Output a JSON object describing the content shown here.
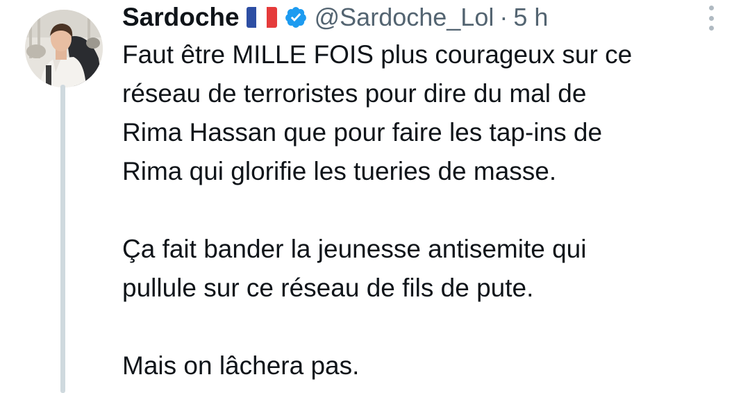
{
  "tweet": {
    "author": {
      "display_name": "Sardoche",
      "flag": "France flag",
      "verified": true,
      "handle": "@Sardoche_Lol"
    },
    "separator": "·",
    "timestamp": "5 h",
    "more_icon": "more-vertical-icon",
    "text": {
      "paragraph1": [
        "Faut être MILLE FOIS plus courageux sur ce",
        "réseau de terroristes pour dire du mal de",
        "Rima Hassan que pour faire les tap-ins de",
        "Rima qui glorifie les tueries de masse."
      ],
      "paragraph2": [
        "Ça fait bander la jeunesse antisemite qui",
        "pullule sur ce réseau de fils de pute."
      ],
      "paragraph3": [
        "Mais on lâchera pas."
      ]
    }
  },
  "colors": {
    "text_primary": "#0f1419",
    "text_secondary": "#536471",
    "verified_blue": "#1d9bf0",
    "thread_line": "#cfd9de"
  }
}
